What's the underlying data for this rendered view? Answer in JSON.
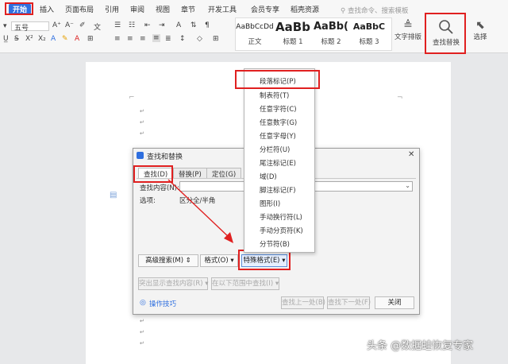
{
  "ribbon": {
    "tabs": [
      "开始",
      "插入",
      "页面布局",
      "引用",
      "审阅",
      "视图",
      "章节",
      "开发工具",
      "会员专享",
      "稻壳资源"
    ],
    "search_placeholder": "查找命令、搜索模板",
    "font_size": "五号",
    "styles": [
      {
        "sample": "AaBbCcDd",
        "name": "正文"
      },
      {
        "sample": "AaBb",
        "name": "标题 1"
      },
      {
        "sample": "AaBb(",
        "name": "标题 2"
      },
      {
        "sample": "AaBbC",
        "name": "标题 3"
      }
    ],
    "text_layout_label": "文字排版",
    "find_replace_label": "查找替换",
    "select_label": "选择"
  },
  "dialog": {
    "title": "查找和替换",
    "tabs": [
      "查找(D)",
      "替换(P)",
      "定位(G)"
    ],
    "find_label": "查找内容(N):",
    "options_label": "选项:",
    "options_value": "区分全/半角",
    "advanced_search": "高级搜索(M)",
    "format": "格式(O)",
    "special_format": "特殊格式(E)",
    "highlight": "突出显示查找内容(R)",
    "find_in": "在以下范围中查找(I)",
    "tips": "操作技巧",
    "find_prev": "查找上一处(B)",
    "find_next": "查找下一处(F)",
    "close": "关闭"
  },
  "menu": {
    "items": [
      "段落标记(P)",
      "制表符(T)",
      "任意字符(C)",
      "任意数字(G)",
      "任意字母(Y)",
      "分栏符(U)",
      "尾注标记(E)",
      "域(D)",
      "脚注标记(F)",
      "图形(I)",
      "手动换行符(L)",
      "手动分页符(K)",
      "分节符(B)"
    ]
  },
  "watermark": "头条 @数据蛙恢复专家",
  "colors": {
    "accent": "#2f6fdf",
    "highlight_box": "#e02020"
  }
}
